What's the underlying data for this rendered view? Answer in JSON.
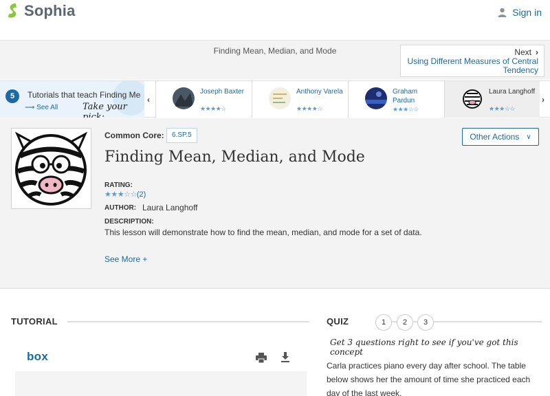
{
  "header": {
    "brand": "Sophia",
    "signin_label": "Sign in",
    "brand_color": "#8cc63f",
    "link_color": "#1a6aa8"
  },
  "titlebar": {
    "title": "Finding Mean, Median, and Mode",
    "next_label": "Next",
    "next_link": "Using Different Measures of Central Tendency"
  },
  "strip": {
    "count": "5",
    "text": "Tutorials that teach Finding Mean, Median, and Mode",
    "see_all": "See All",
    "pick": "Take your pick:",
    "cards": [
      {
        "name": "Joseph Baxter",
        "stars": "★★★★☆"
      },
      {
        "name": "Anthony Varela",
        "stars": "★★★★☆"
      },
      {
        "name": "Graham Pardun",
        "stars": "★★★☆☆"
      },
      {
        "name": "Laura Langhoff",
        "stars": "★★★☆☆"
      }
    ]
  },
  "info": {
    "common_core_label": "Common Core:",
    "common_core_tag": "6.SP.5",
    "other_actions": "Other Actions",
    "title": "Finding Mean, Median, and Mode",
    "rating_label": "RATING:",
    "rating_stars": "★★★☆☆",
    "rating_count": "(2)",
    "author_label": "AUTHOR:",
    "author": "Laura Langhoff",
    "description_label": "DESCRIPTION:",
    "description": "This lesson will demonstrate how to find the mean, median, and mode for a set of data.",
    "see_more": "See More +"
  },
  "tutorial": {
    "heading": "TUTORIAL",
    "viewer_brand": "box"
  },
  "quiz": {
    "heading": "QUIZ",
    "numbers": [
      "1",
      "2",
      "3"
    ],
    "hint": "Get 3 questions right to see if you've got this concept",
    "question": "Carla practices piano every day after school. The table below shows her the amount of time she practiced each day of the last week."
  }
}
